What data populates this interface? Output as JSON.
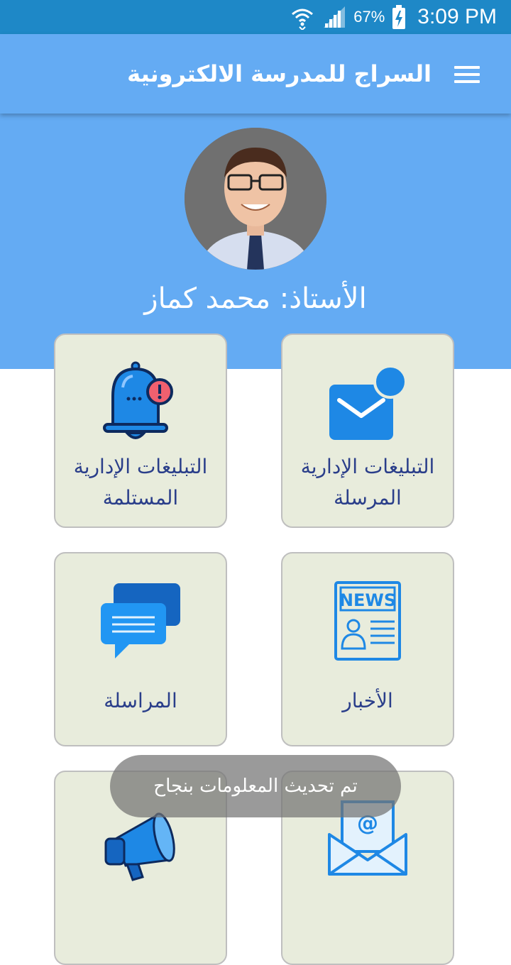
{
  "status": {
    "battery": "67%",
    "time": "3:09 PM"
  },
  "header": {
    "title": "السراج للمدرسة الالكترونية"
  },
  "profile": {
    "teacher_name": "الأستاذ: محمد كماز"
  },
  "cards": [
    {
      "label_1": "التبليغات الإدارية",
      "label_2": "المرسلة",
      "icon": "mail-notification-icon"
    },
    {
      "label_1": "التبليغات الإدارية",
      "label_2": "المستلمة",
      "icon": "bell-alert-icon"
    },
    {
      "label_1": "الأخبار",
      "icon": "news-icon",
      "icon_text": "NEWS"
    },
    {
      "label_1": "المراسلة",
      "icon": "chat-bubbles-icon"
    },
    {
      "icon": "email-envelope-icon",
      "icon_text": "@"
    },
    {
      "icon": "megaphone-icon"
    }
  ],
  "toast": {
    "message": "تم تحديث المعلومات بنجاح"
  },
  "colors": {
    "status_bar": "#1e88c7",
    "app_bar": "#64abf3",
    "card_bg": "#e8ecdc",
    "label_text": "#2a3e8a",
    "icon_blue": "#1e88e5"
  }
}
